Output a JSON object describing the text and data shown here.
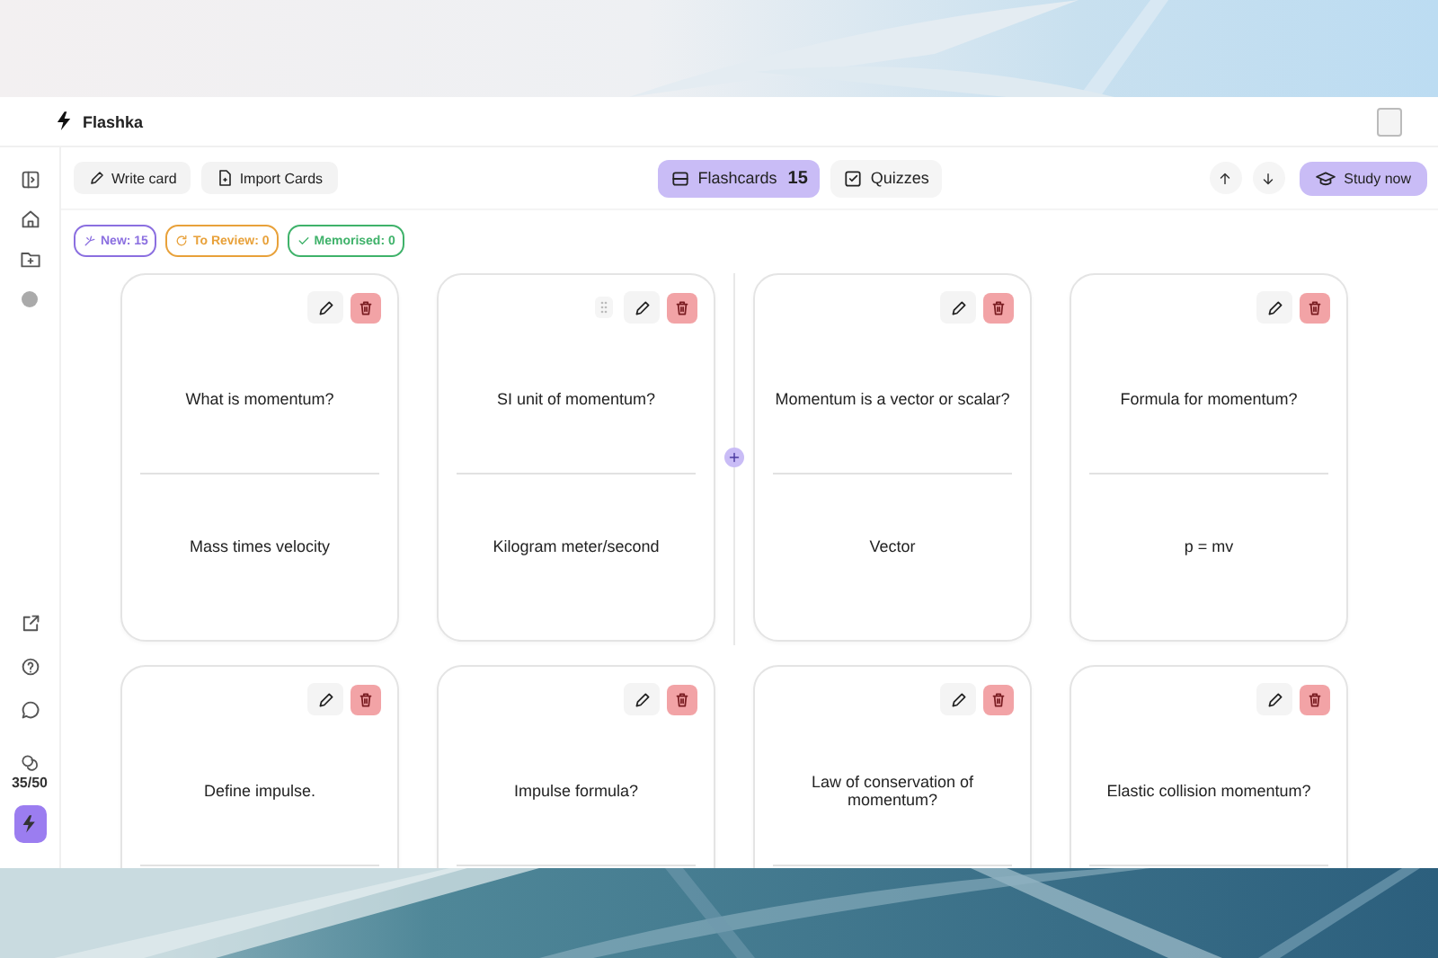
{
  "header": {
    "app_name": "Flashka"
  },
  "toolbar": {
    "actions": [
      {
        "label": "Write card",
        "kind": "write"
      },
      {
        "label": "Import Cards",
        "kind": "import"
      }
    ],
    "tabs": [
      {
        "label": "Flashcards",
        "count": "15",
        "selected": true,
        "kind": "flashcards"
      },
      {
        "label": "Quizzes",
        "selected": false,
        "kind": "quizzes"
      }
    ],
    "study_button": "Study now"
  },
  "filters": [
    {
      "label": "New: 15",
      "color": "#8b6fe0",
      "kind": "new"
    },
    {
      "label": "To Review: 0",
      "color": "#e8a13a",
      "kind": "review"
    },
    {
      "label": "Memorised: 0",
      "color": "#3fb26a",
      "kind": "memorised"
    }
  ],
  "sidebar": {
    "credits": "35/50"
  },
  "cards": [
    {
      "front": "What is momentum?",
      "back": "Mass times velocity",
      "drag_handle": false
    },
    {
      "front": "SI unit of momentum?",
      "back": "Kilogram meter/second",
      "drag_handle": true
    },
    {
      "front": "Momentum is a vector or scalar?",
      "back": "Vector",
      "drag_handle": false
    },
    {
      "front": "Formula for momentum?",
      "back": "p = mv",
      "drag_handle": false
    },
    {
      "front": "Define impulse.",
      "drag_handle": false
    },
    {
      "front": "Impulse formula?",
      "drag_handle": false
    },
    {
      "front": "Law of conservation of momentum?",
      "drag_handle": false
    },
    {
      "front": "Elastic collision momentum?",
      "drag_handle": false
    }
  ]
}
